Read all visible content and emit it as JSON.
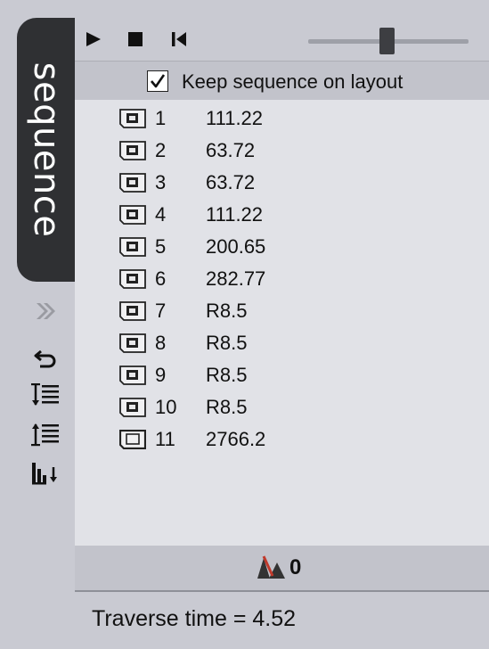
{
  "sidebar": {
    "tab_label": "sequence",
    "icons": [
      "expand-chevron-icon",
      "undo-arrow-icon",
      "sort-down-icon",
      "sort-up-icon",
      "sort-bars-icon"
    ]
  },
  "toolbar": {
    "icons": [
      "play-icon",
      "stop-icon",
      "rewind-icon"
    ],
    "slider_value_fraction": 0.49
  },
  "keep_sequence": {
    "label": "Keep sequence on layout",
    "checked": true
  },
  "rows": [
    {
      "num": "1",
      "value": "111.22",
      "icon": "part-icon"
    },
    {
      "num": "2",
      "value": "63.72",
      "icon": "part-icon"
    },
    {
      "num": "3",
      "value": "63.72",
      "icon": "part-icon"
    },
    {
      "num": "4",
      "value": "111.22",
      "icon": "part-icon"
    },
    {
      "num": "5",
      "value": "200.65",
      "icon": "part-icon"
    },
    {
      "num": "6",
      "value": "282.77",
      "icon": "part-icon"
    },
    {
      "num": "7",
      "value": "R8.5",
      "icon": "part-icon"
    },
    {
      "num": "8",
      "value": "R8.5",
      "icon": "part-icon"
    },
    {
      "num": "9",
      "value": "R8.5",
      "icon": "part-icon"
    },
    {
      "num": "10",
      "value": "R8.5",
      "icon": "part-icon"
    },
    {
      "num": "11",
      "value": "2766.2",
      "icon": "outline-part-icon"
    }
  ],
  "counter": {
    "value": "0",
    "icon": "collision-peaks-icon"
  },
  "footer": {
    "traverse_text": "Traverse time = 4.52"
  },
  "colors": {
    "accent_red": "#c0392b",
    "tab_dark": "#2f3033"
  }
}
